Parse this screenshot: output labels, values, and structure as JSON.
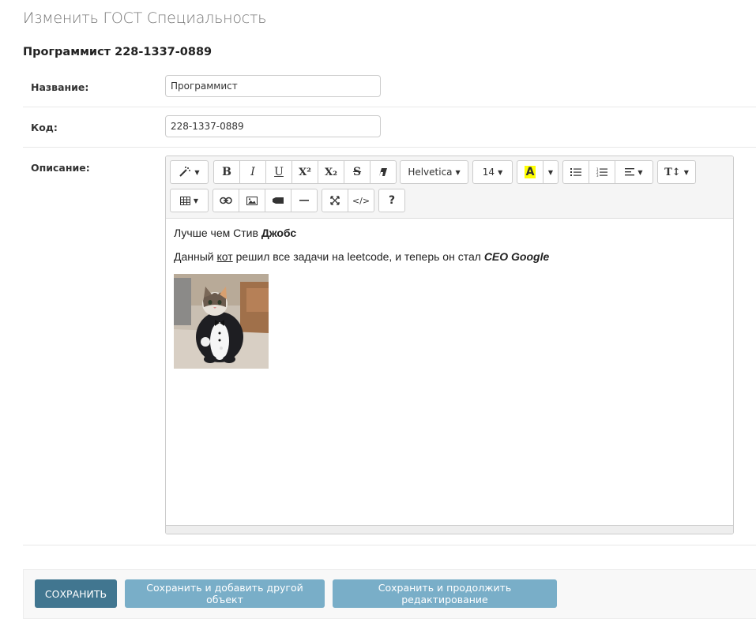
{
  "header": {
    "title": "Изменить ГОСТ Специальность",
    "object_title": "Программист 228-1337-0889"
  },
  "form": {
    "name_label": "Название:",
    "name_value": "Программист",
    "code_label": "Код:",
    "code_value": "228-1337-0889",
    "desc_label": "Описание:"
  },
  "editor": {
    "toolbar": {
      "font_name": "Helvetica",
      "font_size": "14",
      "bold": "B",
      "italic": "I",
      "underline": "U",
      "superscript": "X²",
      "subscript": "X₂",
      "strikethrough": "S",
      "code_view": "</>",
      "help": "?",
      "highlight_letter": "A",
      "highlight_color": "#ffff00",
      "icons": [
        "magic-icon",
        "eraser-icon",
        "list-ul-icon",
        "list-ol-icon",
        "align-icon",
        "line-height-icon",
        "table-icon",
        "link-icon",
        "picture-icon",
        "video-icon",
        "hr-icon",
        "fullscreen-icon"
      ]
    },
    "content": {
      "line1_text": "Лучше чем Стив ",
      "line1_bold": "Джобс",
      "line2_a": "Данный ",
      "line2_underlined": "кот",
      "line2_b": " решил все задачи на leetcode, и теперь он стал ",
      "line2_bold_italic": "CEO Google"
    }
  },
  "actions": {
    "save": "СОХРАНИТЬ",
    "save_add": "Сохранить и добавить другой объект",
    "save_continue": "Сохранить и продолжить редактирование"
  },
  "colors": {
    "primary_button": "#417690",
    "secondary_button": "#79aec8"
  }
}
